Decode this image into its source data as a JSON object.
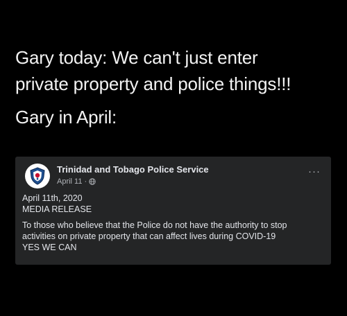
{
  "caption": {
    "line1": "Gary today: We can't just enter",
    "line2": "private property and police things!!!",
    "line3": "Gary in April:"
  },
  "post": {
    "page_name": "Trinidad and Tobago Police Service",
    "date": "April 11",
    "separator": "·",
    "more_label": "···",
    "body": {
      "line1": "April 11th, 2020",
      "line2": "MEDIA RELEASE",
      "line3": "To those who believe that the Police do not have the authority to stop",
      "line4": "activities on private property that can affect lives during COVID-19",
      "line5": "YES WE CAN"
    },
    "avatar_icon": "police-crest-icon",
    "audience_icon": "globe-icon"
  },
  "colors": {
    "background": "#000000",
    "card": "#242526",
    "text_primary": "#e4e6eb",
    "text_secondary": "#b0b3b8"
  }
}
